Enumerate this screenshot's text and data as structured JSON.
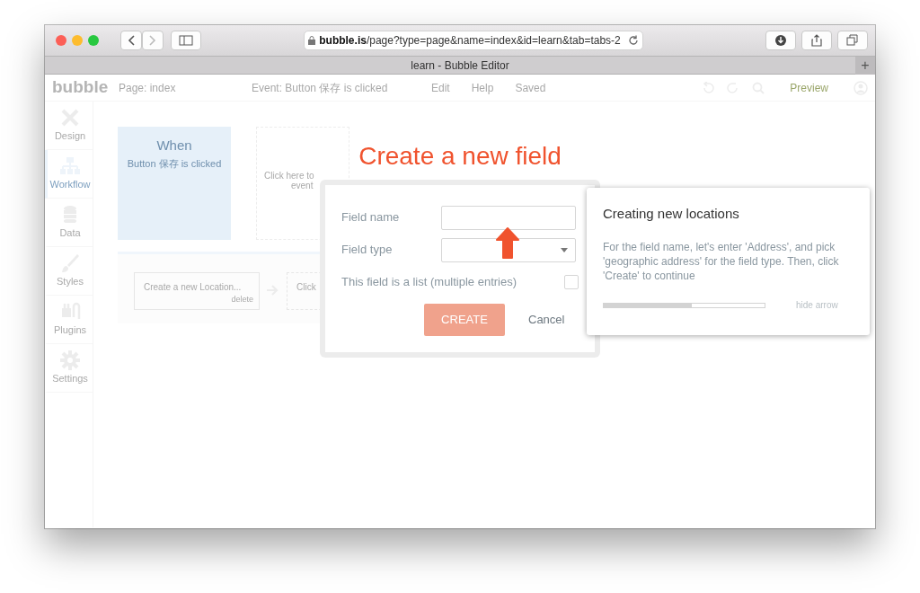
{
  "browser": {
    "url_host": "bubble.is",
    "url_path": "/page?type=page&name=index&id=learn&tab=tabs-2",
    "tab_title": "learn - Bubble Editor",
    "new_tab": "+"
  },
  "editor": {
    "logo": "bubble",
    "page_selector": "Page: index",
    "event_selector": "Event: Button 保存 is clicked",
    "menu": [
      "Edit",
      "Help"
    ],
    "save_status": "Saved",
    "preview": "Preview",
    "sidebar": [
      {
        "label": "Design",
        "selected": false
      },
      {
        "label": "Workflow",
        "selected": true
      },
      {
        "label": "Data",
        "selected": false
      },
      {
        "label": "Styles",
        "selected": false
      },
      {
        "label": "Plugins",
        "selected": false
      },
      {
        "label": "Settings",
        "selected": false
      }
    ],
    "event_card": {
      "title": "When",
      "subtitle": "Button 保存 is clicked"
    },
    "add_event": [
      "Click here to",
      "event"
    ],
    "action": {
      "label": "Create a new Location...",
      "delete": "delete"
    },
    "next_action": "Click"
  },
  "modal": {
    "title": "Create a new field",
    "fields": [
      {
        "kind": "text",
        "label": "Field name"
      },
      {
        "kind": "select",
        "label": "Field type"
      }
    ],
    "list_option": {
      "label": "This field is a list (multiple entries)",
      "checked": false
    },
    "create": "CREATE",
    "cancel": "Cancel"
  },
  "tour": {
    "title": "Creating new locations",
    "text": "For the field name, let's enter 'Address', and pick 'geographic address' for the field type. Then, click 'Create' to continue",
    "level": 0.55,
    "hide": "hide arrow"
  }
}
